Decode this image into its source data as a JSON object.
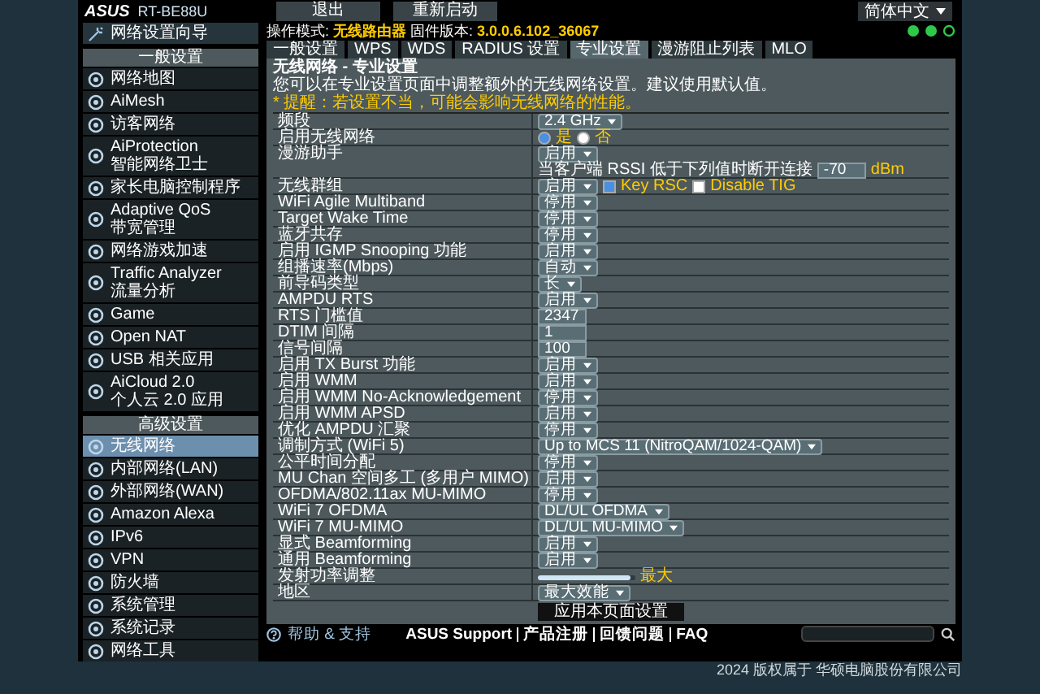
{
  "header": {
    "logo": "ASUS",
    "model": "RT-BE88U",
    "buttons": [
      "退出",
      "重新启动"
    ],
    "language": "简体中文"
  },
  "status": {
    "mode_label": "操作模式:",
    "mode": "无线路由器",
    "firmware_label": "固件版本:",
    "firmware": "3.0.0.6.102_36067"
  },
  "sidebar": {
    "wizard": "网络设置向导",
    "sections": [
      {
        "title": "一般设置",
        "items": [
          {
            "label": "网络地图",
            "selected": false
          },
          {
            "label": "AiMesh",
            "selected": false
          },
          {
            "label": "访客网络",
            "selected": false
          },
          {
            "label": "AiProtection",
            "sublabel": "智能网络卫士",
            "selected": false
          },
          {
            "label": "家长电脑控制程序",
            "selected": false
          },
          {
            "label": "Adaptive QoS",
            "sublabel": "带宽管理",
            "selected": false
          },
          {
            "label": "网络游戏加速",
            "selected": false
          },
          {
            "label": "Traffic Analyzer",
            "sublabel": "流量分析",
            "selected": false
          },
          {
            "label": "Game",
            "selected": false
          },
          {
            "label": "Open NAT",
            "selected": false
          },
          {
            "label": "USB 相关应用",
            "selected": false
          },
          {
            "label": "AiCloud 2.0",
            "sublabel": "个人云 2.0 应用",
            "selected": false
          }
        ]
      },
      {
        "title": "高级设置",
        "items": [
          {
            "label": "无线网络",
            "selected": true
          },
          {
            "label": "内部网络(LAN)",
            "selected": false
          },
          {
            "label": "外部网络(WAN)",
            "selected": false
          },
          {
            "label": "Amazon Alexa",
            "selected": false
          },
          {
            "label": "IPv6",
            "selected": false
          },
          {
            "label": "VPN",
            "selected": false
          },
          {
            "label": "防火墙",
            "selected": false
          },
          {
            "label": "系统管理",
            "selected": false
          },
          {
            "label": "系统记录",
            "selected": false
          },
          {
            "label": "网络工具",
            "selected": false
          }
        ]
      }
    ]
  },
  "tabs": [
    {
      "label": "一般设置",
      "selected": false
    },
    {
      "label": "WPS",
      "selected": false
    },
    {
      "label": "WDS",
      "selected": false
    },
    {
      "label": "RADIUS 设置",
      "selected": false
    },
    {
      "label": "专业设置",
      "selected": true
    },
    {
      "label": "漫游阻止列表",
      "selected": false
    },
    {
      "label": "MLO",
      "selected": false
    }
  ],
  "panel": {
    "title": "无线网络 - 专业设置",
    "description": "您可以在专业设置页面中调整额外的无线网络设置。建议使用默认值。",
    "note": "* 提醒：若设置不当，可能会影响无线网络的性能。",
    "rows": [
      {
        "label": "频段",
        "kind": "select",
        "value": "2.4 GHz"
      },
      {
        "label": "启用无线网络",
        "kind": "radio",
        "options": [
          {
            "label": "是",
            "selected": true
          },
          {
            "label": "否",
            "selected": false
          }
        ]
      },
      {
        "label": "漫游助手",
        "kind": "select_rssi",
        "value": "启用",
        "text": "当客户端 RSSI 低于下列值时断开连接",
        "input": "-70",
        "unit": "dBm"
      },
      {
        "label": "无线群组",
        "kind": "select_checks",
        "value": "启用",
        "checks": [
          {
            "label": "Key RSC",
            "checked": true
          },
          {
            "label": "Disable TIG",
            "checked": false
          }
        ]
      },
      {
        "label": "WiFi Agile Multiband",
        "kind": "select",
        "value": "停用"
      },
      {
        "label": "Target Wake Time",
        "kind": "select",
        "value": "停用"
      },
      {
        "label": "蓝牙共存",
        "kind": "select",
        "value": "停用"
      },
      {
        "label": "启用 IGMP Snooping 功能",
        "kind": "select",
        "value": "启用"
      },
      {
        "label": "组播速率(Mbps)",
        "kind": "select",
        "value": "自动"
      },
      {
        "label": "前导码类型",
        "kind": "select",
        "value": "长"
      },
      {
        "label": "AMPDU RTS",
        "kind": "select",
        "value": "启用"
      },
      {
        "label": "RTS 门槛值",
        "kind": "input",
        "value": "2347"
      },
      {
        "label": "DTIM 间隔",
        "kind": "input",
        "value": "1"
      },
      {
        "label": "信号间隔",
        "kind": "input",
        "value": "100"
      },
      {
        "label": "启用 TX Burst 功能",
        "kind": "select",
        "value": "启用"
      },
      {
        "label": "启用 WMM",
        "kind": "select",
        "value": "启用"
      },
      {
        "label": "启用 WMM No-Acknowledgement",
        "kind": "select",
        "value": "停用"
      },
      {
        "label": "启用 WMM APSD",
        "kind": "select",
        "value": "启用"
      },
      {
        "label": "优化 AMPDU 汇聚",
        "kind": "select",
        "value": "停用"
      },
      {
        "label": "调制方式 (WiFi 5)",
        "kind": "select",
        "value": "Up to MCS 11 (NitroQAM/1024-QAM)"
      },
      {
        "label": "公平时间分配",
        "kind": "select",
        "value": "停用"
      },
      {
        "label": "MU Chan 空间多工 (多用户 MIMO)",
        "kind": "select",
        "value": "启用"
      },
      {
        "label": "OFDMA/802.11ax MU-MIMO",
        "kind": "select",
        "value": "停用"
      },
      {
        "label": "WiFi 7 OFDMA",
        "kind": "select",
        "value": "DL/UL OFDMA"
      },
      {
        "label": "WiFi 7 MU-MIMO",
        "kind": "select",
        "value": "DL/UL MU-MIMO"
      },
      {
        "label": "显式 Beamforming",
        "kind": "select",
        "value": "启用"
      },
      {
        "label": "通用 Beamforming",
        "kind": "select",
        "value": "启用"
      },
      {
        "label": "发射功率调整",
        "kind": "slider",
        "level": 0.95,
        "reading": "最大"
      },
      {
        "label": "地区",
        "kind": "select",
        "value": "最大效能"
      }
    ]
  },
  "apply_button": "应用本页面设置",
  "footer": {
    "help": "帮助 & 支持",
    "links": [
      "ASUS Support",
      "产品注册",
      "回馈问题",
      "FAQ"
    ],
    "copyright": "2024 版权属于 华硕电脑股份有限公司"
  }
}
